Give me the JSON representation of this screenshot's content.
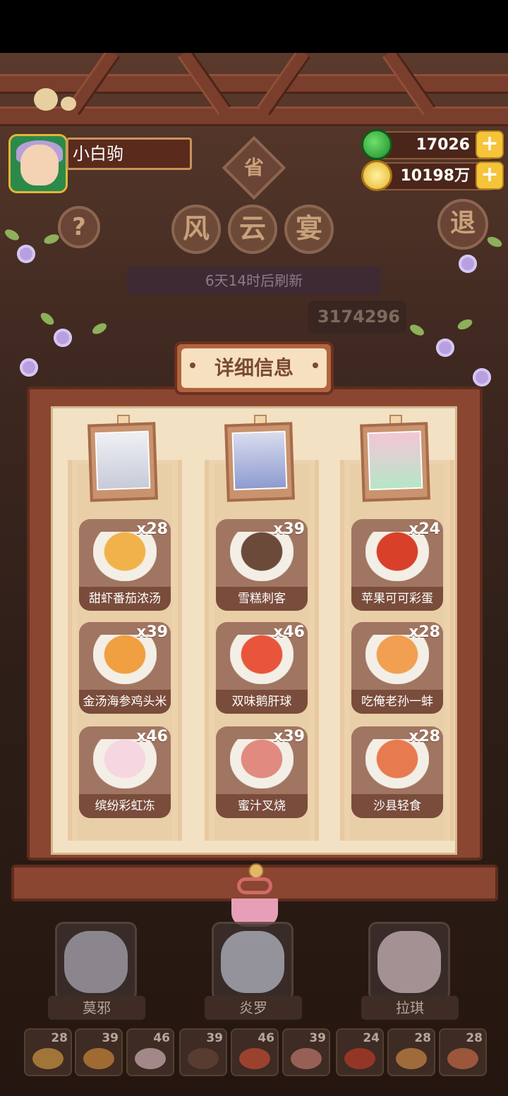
{
  "player": {
    "name": "小白驹"
  },
  "currency": {
    "jade": "17026",
    "coins": "10198万",
    "plus_label": "+"
  },
  "top": {
    "help_label": "?",
    "exit_label": "退",
    "province_label": "省",
    "title_chars": [
      "风",
      "云",
      "宴"
    ],
    "refresh_text": "6天14时后刷新",
    "score_text": "3174296"
  },
  "panel": {
    "title": "详细信息",
    "columns": [
      {
        "dishes": [
          {
            "count": "x28",
            "name": "甜虾番茄浓汤",
            "color": "#f2b24a"
          },
          {
            "count": "x39",
            "name": "金汤海参鸡头米",
            "color": "#f0a040"
          },
          {
            "count": "x46",
            "name": "缤纷彩虹冻",
            "color": "#f6d6e0"
          }
        ]
      },
      {
        "dishes": [
          {
            "count": "x39",
            "name": "雪糕刺客",
            "color": "#6b4a3a"
          },
          {
            "count": "x46",
            "name": "双味鹅肝球",
            "color": "#e8553a"
          },
          {
            "count": "x39",
            "name": "蜜汁叉烧",
            "color": "#e08a80"
          }
        ]
      },
      {
        "dishes": [
          {
            "count": "x24",
            "name": "苹果可可彩蛋",
            "color": "#d8402a"
          },
          {
            "count": "x28",
            "name": "吃俺老孙一蚌",
            "color": "#f0a050"
          },
          {
            "count": "x28",
            "name": "沙县轻食",
            "color": "#e87a50"
          }
        ]
      }
    ]
  },
  "characters": [
    {
      "name": "莫邪"
    },
    {
      "name": "炎罗"
    },
    {
      "name": "拉琪"
    }
  ],
  "bottom_slots": [
    {
      "count": "28",
      "color": "#f2b24a"
    },
    {
      "count": "39",
      "color": "#f0a040"
    },
    {
      "count": "46",
      "color": "#f6d6e0"
    },
    {
      "count": "39",
      "color": "#6b4a3a"
    },
    {
      "count": "46",
      "color": "#e8553a"
    },
    {
      "count": "39",
      "color": "#e08a80"
    },
    {
      "count": "24",
      "color": "#d8402a"
    },
    {
      "count": "28",
      "color": "#f0a050"
    },
    {
      "count": "28",
      "color": "#e87a50"
    }
  ]
}
